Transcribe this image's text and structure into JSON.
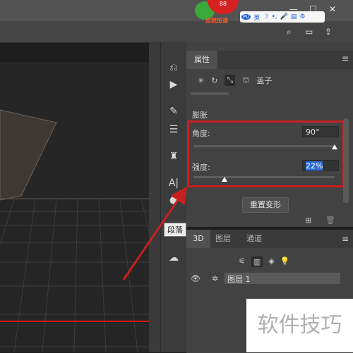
{
  "topbar": {
    "badge_count": "88",
    "boost_label": "点我加速",
    "ime_items": [
      "英",
      "☽",
      "•,",
      "🎤",
      "▤",
      "⚙"
    ],
    "ime_logo": "PU",
    "window_controls": [
      "—",
      "☐",
      "✕"
    ],
    "toolbar_icons": [
      "search-icon",
      "layout-icon",
      "export-icon"
    ]
  },
  "toolstrip": {
    "tooltip": "段落",
    "tools": [
      "history-icon",
      "play-icon",
      "brush-settings-icon",
      "adjust-icon",
      "stamp-icon",
      "text-icon",
      "comment-icon",
      "creative-cloud-icon"
    ]
  },
  "properties": {
    "tab": "属性",
    "mode_icons": [
      "light-icon",
      "rotate-icon",
      "deform-icon",
      "cap-icon"
    ],
    "mode_label": "盖子",
    "section": "膨胀",
    "angle_label": "角度:",
    "angle_value": "90°",
    "angle_level": 1.0,
    "strength_label": "强度:",
    "strength_value": "22%",
    "strength_level": 0.22,
    "reset_button": "重置变形"
  },
  "layers": {
    "tabs": [
      "3D",
      "图层",
      "通道"
    ],
    "layer_name": "图层 1"
  },
  "watermark": "软件技巧",
  "colors": {
    "highlight": "#c81f1f",
    "selection": "#2c6ed8",
    "panel": "#424242"
  }
}
